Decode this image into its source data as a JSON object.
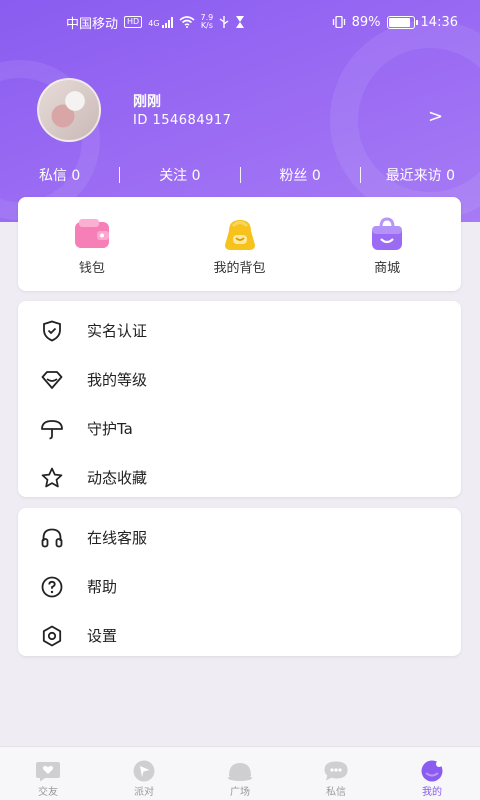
{
  "status_bar": {
    "carrier": "中国移动",
    "hd_badge": "HD",
    "net_type": "4G",
    "speed_value": "7.9",
    "speed_unit": "K/s",
    "battery": "89%",
    "battery_level": 0.89,
    "time": "14:36"
  },
  "profile": {
    "name": "刚刚",
    "id_text": "ID 154684917",
    "arrow": ">"
  },
  "stats": [
    {
      "label": "私信 0"
    },
    {
      "label": "关注 0"
    },
    {
      "label": "粉丝 0"
    },
    {
      "label": "最近来访 0"
    }
  ],
  "stat_separator": "|",
  "quick_actions": [
    {
      "label": "钱包",
      "icon": "wallet-icon"
    },
    {
      "label": "我的背包",
      "icon": "backpack-icon"
    },
    {
      "label": "商城",
      "icon": "shopping-bag-icon"
    }
  ],
  "menu_group_1": [
    {
      "label": "实名认证",
      "icon": "shield-check-icon"
    },
    {
      "label": "我的等级",
      "icon": "diamond-icon"
    },
    {
      "label": "守护Ta",
      "icon": "umbrella-icon"
    },
    {
      "label": "动态收藏",
      "icon": "star-icon"
    }
  ],
  "menu_group_2": [
    {
      "label": "在线客服",
      "icon": "headphones-icon"
    },
    {
      "label": "帮助",
      "icon": "help-icon"
    },
    {
      "label": "设置",
      "icon": "settings-icon"
    }
  ],
  "tabs": [
    {
      "label": "交友",
      "icon": "chat-heart-icon",
      "active": false
    },
    {
      "label": "派对",
      "icon": "party-icon",
      "active": false
    },
    {
      "label": "广场",
      "icon": "square-icon",
      "active": false
    },
    {
      "label": "私信",
      "icon": "message-icon",
      "active": false
    },
    {
      "label": "我的",
      "icon": "me-icon",
      "active": true
    }
  ],
  "colors": {
    "accent": "#8a5cf0",
    "wallet": "#f77fb7",
    "backpack": "#f7c21c",
    "shop": "#9b6cf3",
    "tab_inactive": "#cfcfd3"
  }
}
